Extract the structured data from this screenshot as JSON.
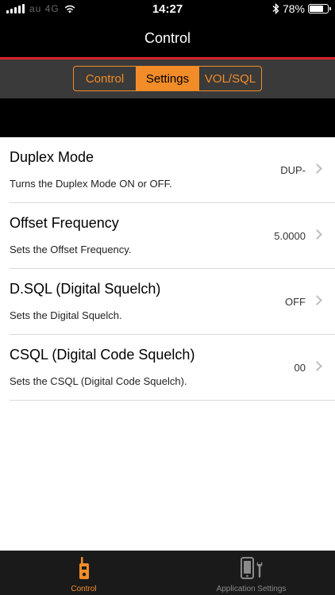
{
  "status_bar": {
    "carrier": "au 4G",
    "time": "14:27",
    "battery_percent": "78%",
    "battery_level": 0.78,
    "icons": [
      "signal-icon",
      "wifi-icon",
      "bluetooth-icon",
      "battery-icon"
    ]
  },
  "nav": {
    "title": "Control"
  },
  "segments": [
    {
      "label": "Control",
      "active": false
    },
    {
      "label": "Settings",
      "active": true
    },
    {
      "label": "VOL/SQL",
      "active": false
    }
  ],
  "settings": [
    {
      "title": "Duplex Mode",
      "description": "Turns the Duplex Mode ON or OFF.",
      "value": "DUP-"
    },
    {
      "title": "Offset Frequency",
      "description": "Sets the Offset Frequency.",
      "value": "5.0000"
    },
    {
      "title": "D.SQL (Digital Squelch)",
      "description": "Sets the Digital Squelch.",
      "value": "OFF"
    },
    {
      "title": "CSQL (Digital Code Squelch)",
      "description": "Sets the CSQL (Digital Code Squelch).",
      "value": "00"
    }
  ],
  "tabs": [
    {
      "label": "Control",
      "icon": "radio-icon",
      "active": true
    },
    {
      "label": "Application Settings",
      "icon": "phone-settings-icon",
      "active": false
    }
  ],
  "colors": {
    "accent": "#f28c28",
    "red_line": "#d6242a",
    "strip": "#3a3a3a",
    "tab_bar": "#1a1a1a"
  }
}
